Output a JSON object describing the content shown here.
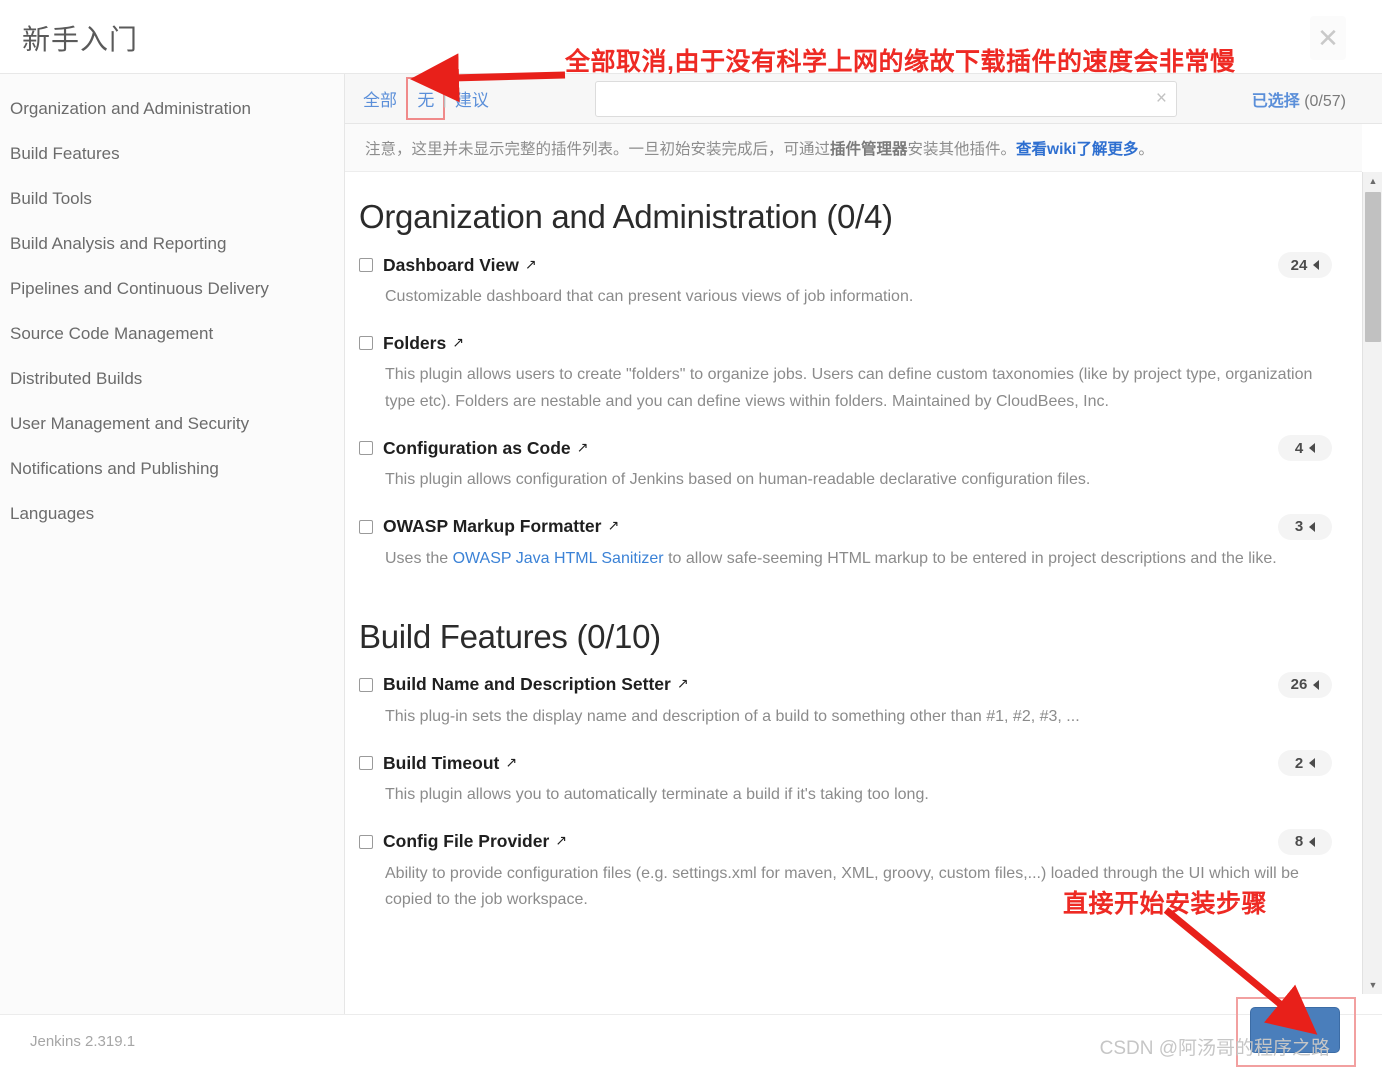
{
  "dialog": {
    "title": "新手入门",
    "close_icon": "close-icon"
  },
  "sidebar": {
    "items": [
      {
        "label": "Organization and Administration"
      },
      {
        "label": "Build Features"
      },
      {
        "label": "Build Tools"
      },
      {
        "label": "Build Analysis and Reporting"
      },
      {
        "label": "Pipelines and Continuous Delivery"
      },
      {
        "label": "Source Code Management"
      },
      {
        "label": "Distributed Builds"
      },
      {
        "label": "User Management and Security"
      },
      {
        "label": "Notifications and Publishing"
      },
      {
        "label": "Languages"
      }
    ]
  },
  "filter_bar": {
    "all_label": "全部",
    "none_label": "无",
    "suggested_label": "建议",
    "separator": "|",
    "search_value": "",
    "search_placeholder": "",
    "clear_icon": "×",
    "selected_label": "已选择",
    "selected_count": "(0/57)"
  },
  "notice": {
    "part1": "注意，这里并未显示完整的插件列表。一旦初始安装完成后，可通过",
    "bold1": "插件管理器",
    "part2": "安装其他插件。",
    "link": "查看wiki了解更多",
    "part3": "。"
  },
  "categories": [
    {
      "title": "Organization and Administration (0/4)",
      "plugins": [
        {
          "name": "Dashboard View",
          "badge": "24",
          "desc": "Customizable dashboard that can present various views of job information.",
          "checked": false
        },
        {
          "name": "Folders",
          "badge": "",
          "desc": "This plugin allows users to create \"folders\" to organize jobs. Users can define custom taxonomies (like by project type, organization type etc). Folders are nestable and you can define views within folders. Maintained by CloudBees, Inc.",
          "checked": false
        },
        {
          "name": "Configuration as Code",
          "badge": "4",
          "desc": "This plugin allows configuration of Jenkins based on human-readable declarative configuration files.",
          "checked": false
        },
        {
          "name": "OWASP Markup Formatter",
          "badge": "3",
          "desc_pre": "Uses the ",
          "desc_link": "OWASP Java HTML Sanitizer",
          "desc_post": " to allow safe-seeming HTML markup to be entered in project descriptions and the like.",
          "checked": false
        }
      ]
    },
    {
      "title": "Build Features (0/10)",
      "plugins": [
        {
          "name": "Build Name and Description Setter",
          "badge": "26",
          "desc": "This plug-in sets the display name and description of a build to something other than #1, #2, #3, ...",
          "checked": false
        },
        {
          "name": "Build Timeout",
          "badge": "2",
          "desc": "This plugin allows you to automatically terminate a build if it's taking too long.",
          "checked": false
        },
        {
          "name": "Config File Provider",
          "badge": "8",
          "desc": "Ability to provide configuration files (e.g. settings.xml for maven, XML, groovy, custom files,...) loaded through the UI which will be copied to the job workspace.",
          "checked": false
        }
      ]
    }
  ],
  "external_link_icon": "↗",
  "footer": {
    "jenkins_version": "Jenkins 2.319.1",
    "install_button_label": ""
  },
  "annotations": {
    "top": "全部取消,由于没有科学上网的缘故下载插件的速度会非常慢",
    "bottom": "直接开始安装步骤",
    "color": "#ee2a24"
  },
  "watermark": "CSDN @阿汤哥的程序之路",
  "scrollbar": {
    "up_arrow": "▲",
    "down_arrow": "▼"
  }
}
